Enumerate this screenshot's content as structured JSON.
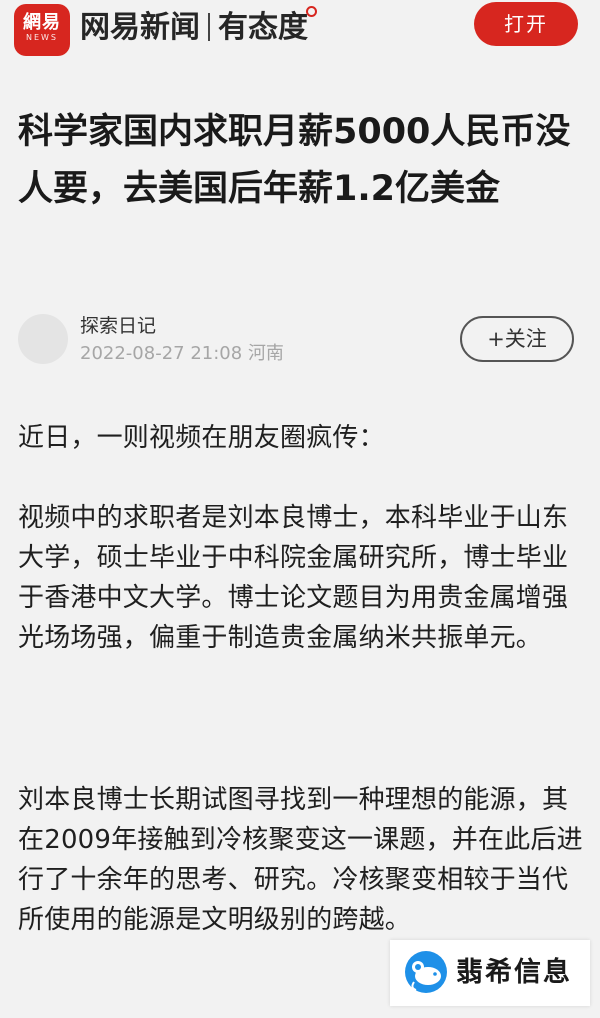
{
  "app_bar": {
    "logo_main": "網易",
    "logo_sub": "NEWS",
    "brand": "网易新闻",
    "slogan": "有态度",
    "open_button_label": "打开",
    "accent_color": "#d7261f"
  },
  "article": {
    "title": "科学家国内求职月薪5000人民币没人要，去美国后年薪1.2亿美金",
    "author": {
      "name": "探索日记",
      "datetime": "2022-08-27 21:08",
      "location": "河南",
      "follow_label": "+关注"
    },
    "paragraphs": [
      "近日，一则视频在朋友圈疯传：",
      "视频中的求职者是刘本良博士，本科毕业于山东大学，硕士毕业于中科院金属研究所，博士毕业于香港中文大学。博士论文题目为用贵金属增强光场场强，偏重于制造贵金属纳米共振单元。",
      "刘本良博士长期试图寻找到一种理想的能源，其在2009年接触到冷核聚变这一课题，并在此后进行了十余年的思考、研究。冷核聚变相较于当代所使用的能源是文明级别的跨越。"
    ]
  },
  "watermark": {
    "text": "翡希信息",
    "icon": "mouse-logo-icon"
  }
}
